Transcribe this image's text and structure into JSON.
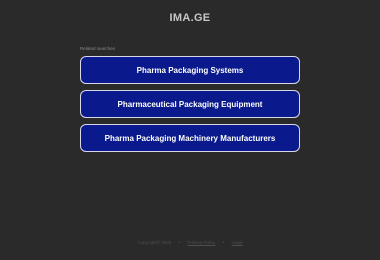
{
  "header": {
    "site_title": "IMA.GE"
  },
  "related": {
    "label": "Related searches",
    "items": [
      {
        "label": "Pharma Packaging Systems"
      },
      {
        "label": "Pharmaceutical Packaging Equipment"
      },
      {
        "label": "Pharma Packaging Machinery Manufacturers"
      }
    ]
  },
  "footer": {
    "copyright": "Copyright© 2025",
    "separator": "•",
    "privacy_label": "Privacy Policy",
    "legal_label": "Legal"
  },
  "colors": {
    "background": "#2a2a2a",
    "button_bg": "#0a1a8c",
    "button_border": "#d8d8e8"
  }
}
